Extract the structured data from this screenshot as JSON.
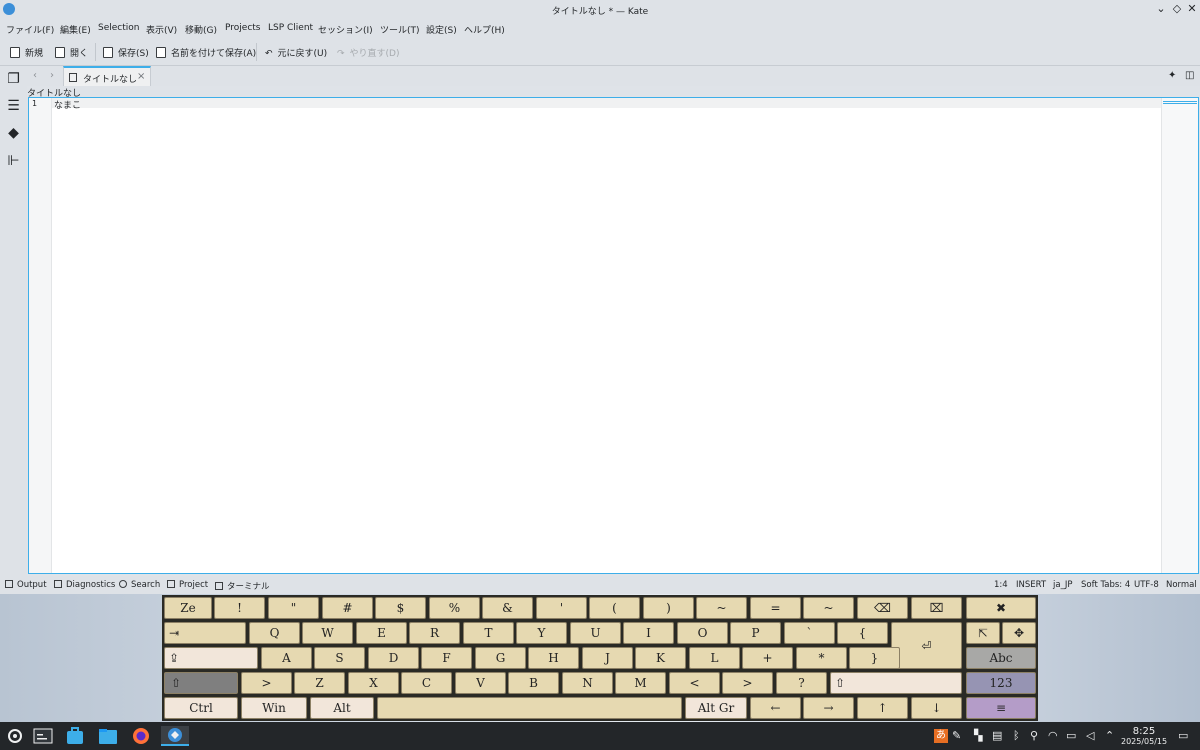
{
  "window": {
    "title": "タイトルなし * — Kate",
    "app_icon": "kate-icon",
    "controls": [
      "chevron-down-icon",
      "diamond-icon",
      "close-icon"
    ]
  },
  "menu": [
    "ファイル(F)",
    "編集(E)",
    "Selection",
    "表示(V)",
    "移動(G)",
    "Projects",
    "LSP Client",
    "セッション(I)",
    "ツール(T)",
    "設定(S)",
    "ヘルプ(H)"
  ],
  "toolbar": {
    "new": "新規",
    "open": "開く",
    "save": "保存(S)",
    "save_as": "名前を付けて保存(A)",
    "undo": "元に戻す(U)",
    "redo": "やり直す(D)"
  },
  "sidebar_icons": [
    "documents-icon",
    "symbols-icon",
    "git-icon",
    "project-tree-icon"
  ],
  "tab": {
    "label": "タイトルなし",
    "close": "×"
  },
  "breadcrumb": "タイトルなし",
  "editor": {
    "line_number": "1",
    "line_text": "なまこ"
  },
  "bottom_tools": [
    "Output",
    "Diagnostics",
    "Search",
    "Project",
    "ターミナル"
  ],
  "status": {
    "cursor": "1:4",
    "mode": "INSERT",
    "language": "ja_JP",
    "indent": "Soft Tabs: 4",
    "encoding": "UTF-8",
    "input_mode": "Normal"
  },
  "keyboard": {
    "row1": [
      "Ze",
      "!",
      "\"",
      "#",
      "$",
      "%",
      "&",
      "'",
      "(",
      ")",
      "~",
      "=",
      "~",
      "⌫",
      "⌧",
      "✖"
    ],
    "row2": [
      "⇥",
      "Q",
      "W",
      "E",
      "R",
      "T",
      "Y",
      "U",
      "I",
      "O",
      "P",
      "`",
      "{",
      "⏎",
      "⇱",
      "✥"
    ],
    "row3": [
      "⇪",
      "A",
      "S",
      "D",
      "F",
      "G",
      "H",
      "J",
      "K",
      "L",
      "+",
      "*",
      "}",
      "Abc"
    ],
    "row4": [
      "⇧",
      ">",
      "Z",
      "X",
      "C",
      "V",
      "B",
      "N",
      "M",
      "<",
      ">",
      "?",
      "⇧",
      "123"
    ],
    "row5": [
      "Ctrl",
      "Win",
      "Alt",
      "",
      "Alt Gr",
      "←",
      "→",
      "↑",
      "↓",
      "≡"
    ]
  },
  "taskbar": {
    "apps": [
      "launcher-icon",
      "terminal-icon",
      "store-icon",
      "files-icon",
      "firefox-icon",
      "kate-icon"
    ],
    "ime": "あ",
    "time": "8:25",
    "date": "2025/05/15"
  },
  "colors": {
    "accent": "#3daee9",
    "key_face": "#e6d9b1",
    "taskbar": "#232629"
  }
}
